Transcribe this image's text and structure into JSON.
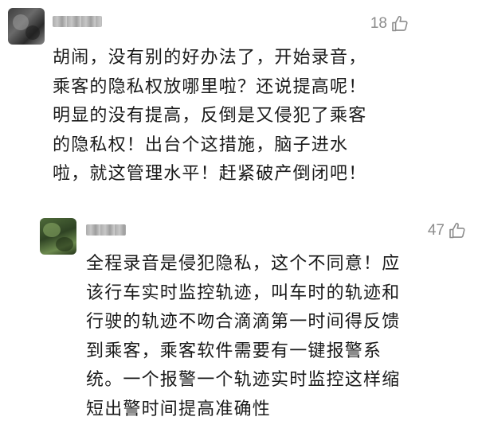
{
  "comments": [
    {
      "likes": "18",
      "text_lines": [
        "胡闹，没有别的好办法了，开始录音，",
        "乘客的隐私权放哪里啦？还说提高呢！",
        "明显的没有提高，反倒是又侵犯了乘客",
        "的隐私权！出台个这措施，脑子进水",
        "啦，就这管理水平！赶紧破产倒闭吧！"
      ]
    },
    {
      "likes": "47",
      "text_lines": [
        "全程录音是侵犯隐私，这个不同意！应",
        "该行车实时监控轨迹，叫车时的轨迹和",
        "行驶的轨迹不吻合滴滴第一时间得反馈",
        "到乘客，乘客软件需要有一键报警系",
        "统。一个报警一个轨迹实时监控这样缩",
        "短出警时间提高准确性"
      ]
    }
  ],
  "icons": {
    "like": "thumbs-up-outline-icon"
  },
  "colors": {
    "text": "#1a1a1a",
    "meta": "#8c8c8c",
    "background": "#ffffff"
  }
}
